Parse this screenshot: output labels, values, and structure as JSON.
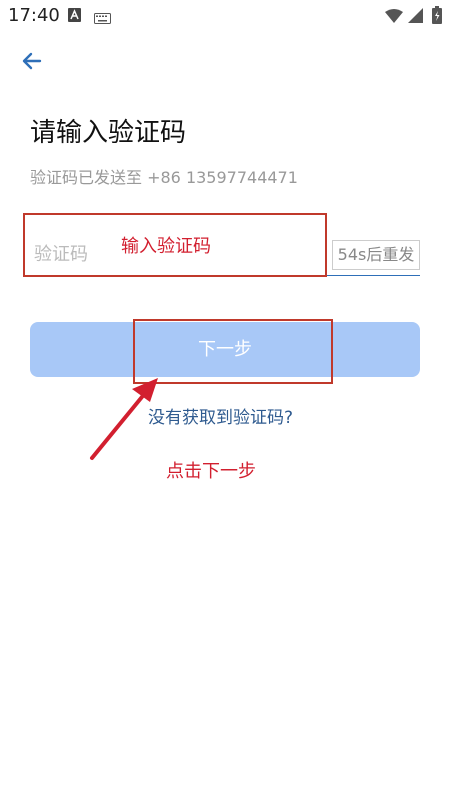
{
  "status_bar": {
    "time": "17:40",
    "icons": [
      "app-icon",
      "keyboard-icon",
      "wifi-icon",
      "signal-icon",
      "battery-icon"
    ]
  },
  "nav": {
    "back_icon": "arrow-left-icon"
  },
  "page": {
    "title": "请输入验证码",
    "subtitle": "验证码已发送至 +86 13597744471"
  },
  "code_field": {
    "placeholder": "验证码",
    "value": ""
  },
  "resend": {
    "label": "54s后重发"
  },
  "next_button": {
    "label": "下一步"
  },
  "no_code_link": {
    "label": "没有获取到验证码?"
  },
  "annotations": {
    "input_hint": "输入验证码",
    "next_hint": "点击下一步",
    "color": "#d21f2f"
  },
  "colors": {
    "primary": "#2e6fb8",
    "button_disabled": "#a8c8f7"
  }
}
